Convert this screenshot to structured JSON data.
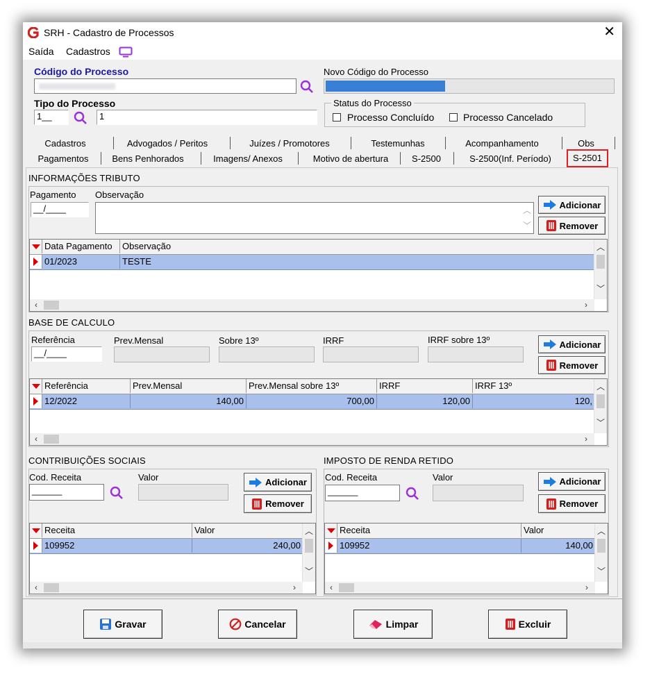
{
  "window": {
    "title": "SRH - Cadastro de Processos"
  },
  "menu": {
    "items": [
      "Saída",
      "Cadastros"
    ]
  },
  "header": {
    "codigo_label": "Código do Processo",
    "novo_codigo_label": "Novo Código do Processo",
    "tipo_label": "Tipo do Processo",
    "tipo_value": "1__",
    "tipo_desc": "1",
    "status_label": "Status do Processo",
    "concluido_label": "Processo Concluído",
    "cancelado_label": "Processo Cancelado"
  },
  "tabs_row1": [
    "Cadastros",
    "Advogados / Peritos",
    "Juízes / Promotores",
    "Testemunhas",
    "Acompanhamento",
    "Obs"
  ],
  "tabs_row2": [
    "Pagamentos",
    "Bens Penhorados",
    "Imagens/ Anexos",
    "Motivo de abertura",
    "S-2500",
    "S-2500(Inf. Período)",
    "S-2501"
  ],
  "tributo": {
    "title": "INFORMAÇÕES TRIBUTO",
    "pagamento_label": "Pagamento",
    "pagamento_value": "__/____",
    "observacao_label": "Observação",
    "add": "Adicionar",
    "remove": "Remover",
    "columns": [
      "Data Pagamento",
      "Observação"
    ],
    "rows": [
      {
        "data": "01/2023",
        "obs": "TESTE"
      }
    ]
  },
  "base": {
    "title": "BASE DE CALCULO",
    "referencia_label": "Referência",
    "referencia_value": "__/____",
    "prev_label": "Prev.Mensal",
    "sobre13_label": "Sobre 13º",
    "irrf_label": "IRRF",
    "irrf13_label": "IRRF sobre  13º",
    "add": "Adicionar",
    "remove": "Remover",
    "columns": [
      "Referência",
      "Prev.Mensal",
      "Prev.Mensal sobre 13º",
      "IRRF",
      "IRRF 13º"
    ],
    "rows": [
      {
        "ref": "12/2022",
        "prev": "140,00",
        "prev13": "700,00",
        "irrf": "120,00",
        "irrf13": "120,"
      }
    ]
  },
  "contrib": {
    "title": "CONTRIBUIÇÕES SOCIAIS",
    "cod_label": "Cod. Receita",
    "cod_value": "______",
    "valor_label": "Valor",
    "add": "Adicionar",
    "remove": "Remover",
    "columns": [
      "Receita",
      "Valor"
    ],
    "rows": [
      {
        "receita": "109952",
        "valor": "240,00"
      }
    ]
  },
  "irrf": {
    "title": "IMPOSTO DE RENDA RETIDO",
    "cod_label": "Cod. Receita",
    "cod_value": "______",
    "valor_label": "Valor",
    "add": "Adicionar",
    "remove": "Remover",
    "columns": [
      "Receita",
      "Valor"
    ],
    "rows": [
      {
        "receita": "109952",
        "valor": "140,00"
      }
    ]
  },
  "footer": {
    "gravar": "Gravar",
    "cancelar": "Cancelar",
    "limpar": "Limpar",
    "excluir": "Excluir"
  },
  "colors": {
    "highlight_row": "#a9c0ec",
    "accent_purple": "#9b30d9",
    "selected_tab_border": "#e02020",
    "novo_codigo_fill": "#3a7fd6"
  }
}
